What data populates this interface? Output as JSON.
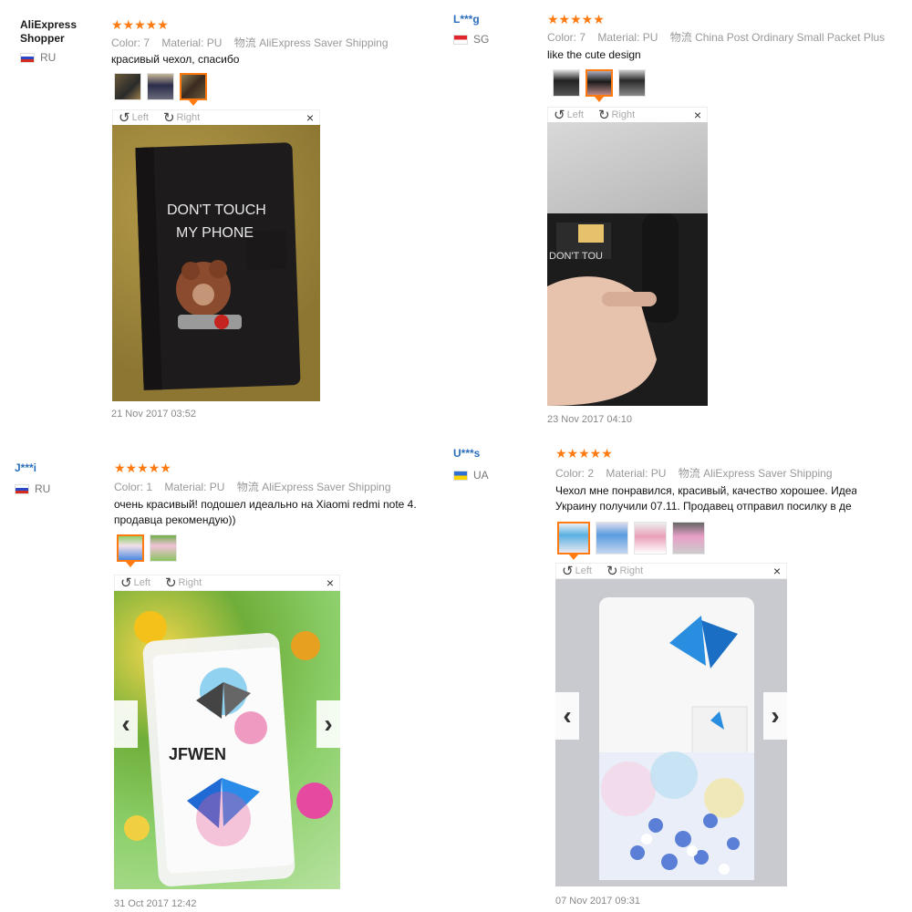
{
  "reviews": [
    {
      "user_line1": "AliExpress",
      "user_line2": "Shopper",
      "country": "RU",
      "stars": "★★★★★",
      "color_label": "Color:",
      "color_value": "7",
      "material_label": "Material:",
      "material_value": "PU",
      "shipping": "物流 AliExpress Saver Shipping",
      "text": "красивый чехол, спасибо",
      "rotate_left": "Left",
      "rotate_right": "Right",
      "close": "×",
      "photo_text_line1": "DON'T TOUCH",
      "photo_text_line2": "MY PHONE",
      "date": "21 Nov 2017 03:52"
    },
    {
      "user": "L***g",
      "country": "SG",
      "stars": "★★★★★",
      "color_label": "Color:",
      "color_value": "7",
      "material_label": "Material:",
      "material_value": "PU",
      "shipping": "物流 China Post Ordinary Small Packet Plus",
      "text": "like the cute design",
      "rotate_left": "Left",
      "rotate_right": "Right",
      "close": "×",
      "photo_text": "DON'T TOU",
      "date": "23 Nov 2017 04:10"
    },
    {
      "user": "J***i",
      "country": "RU",
      "stars": "★★★★★",
      "color_label": "Color:",
      "color_value": "1",
      "material_label": "Material:",
      "material_value": "PU",
      "shipping": "物流 AliExpress Saver Shipping",
      "text_line1": "очень красивый! подошел идеально на Xiaomi redmi note 4.",
      "text_line2": "продавца рекомендую))",
      "rotate_left": "Left",
      "rotate_right": "Right",
      "close": "×",
      "photo_text": "JFWEN",
      "prev": "‹",
      "next": "›",
      "date": "31 Oct 2017 12:42"
    },
    {
      "user": "U***s",
      "country": "UA",
      "stars": "★★★★★",
      "color_label": "Color:",
      "color_value": "2",
      "material_label": "Material:",
      "material_value": "PU",
      "shipping": "物流 AliExpress Saver Shipping",
      "text_line1": "Чехол мне понравился, красивый, качество хорошее. Идеа",
      "text_line2": "Украину получили 07.11. Продавец отправил посилку в де",
      "rotate_left": "Left",
      "rotate_right": "Right",
      "close": "×",
      "prev": "‹",
      "next": "›",
      "date": "07 Nov 2017 09:31"
    }
  ],
  "colors": {
    "accent": "#ff7a10",
    "link": "#2a6ebb"
  }
}
